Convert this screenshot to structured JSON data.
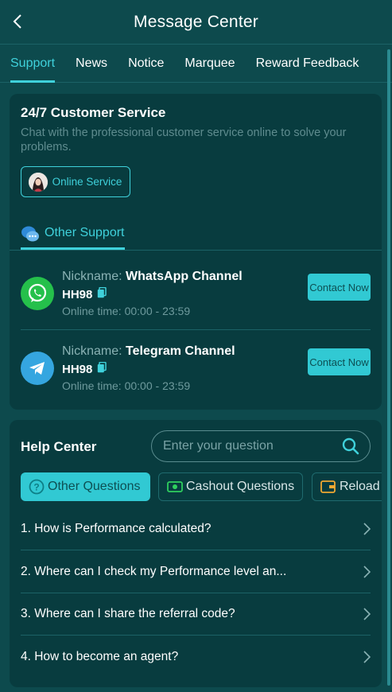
{
  "header": {
    "title": "Message Center"
  },
  "tabs": [
    "Support",
    "News",
    "Notice",
    "Marquee",
    "Reward Feedback"
  ],
  "customer_service": {
    "title": "24/7 Customer Service",
    "description": "Chat with the professional customer service online to solve your problems.",
    "online_button": "Online Service"
  },
  "other_support": {
    "tab_label": "Other Support",
    "channels": [
      {
        "nickname_label": "Nickname:",
        "name": "WhatsApp Channel",
        "code": "HH98",
        "time_label": "Online time:",
        "time": "00:00 - 23:59",
        "button": "Contact Now",
        "icon": "whatsapp-icon"
      },
      {
        "nickname_label": "Nickname:",
        "name": "Telegram Channel",
        "code": "HH98",
        "time_label": "Online time:",
        "time": "00:00 - 23:59",
        "button": "Contact Now",
        "icon": "telegram-icon"
      }
    ]
  },
  "help_center": {
    "title": "Help Center",
    "search_placeholder": "Enter your question",
    "question_tabs": [
      "Other Questions",
      "Cashout Questions",
      "Reload"
    ],
    "faqs": [
      "1. How is Performance calculated?",
      "2. Where can I check my Performance level an...",
      "3. Where can I share the referral code?",
      "4. How to become an agent?"
    ]
  },
  "colors": {
    "accent": "#3fd1db",
    "background": "#0d4a4d",
    "card": "#083c3f",
    "button": "#31c9d3"
  }
}
